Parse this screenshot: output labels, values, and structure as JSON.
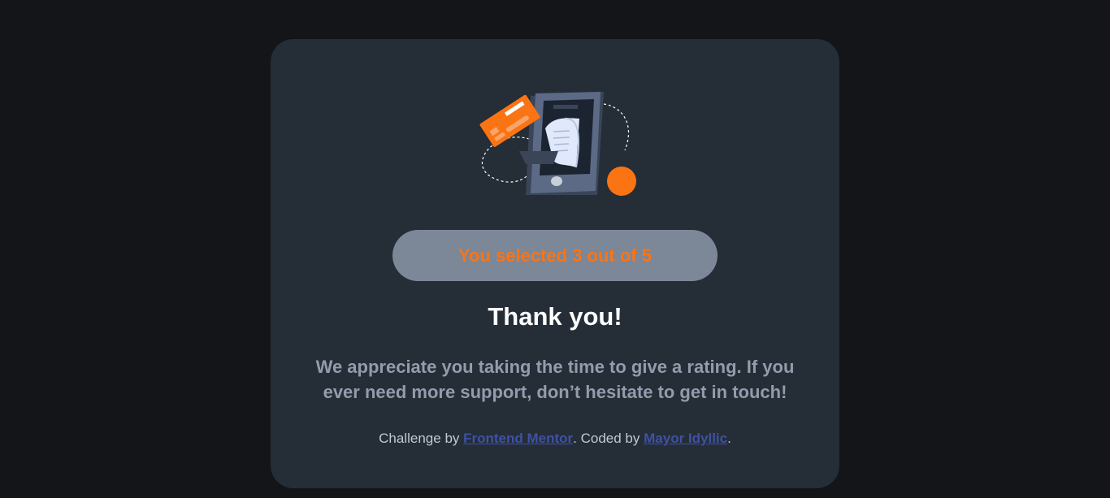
{
  "card": {
    "selected_text": "You selected 3 out of 5",
    "title": "Thank you!",
    "message": "We appreciate you taking the time to give a rating. If you ever need more support, don’t hesitate to get in touch!"
  },
  "attribution": {
    "prefix": "Challenge by ",
    "link1": "Frontend Mentor",
    "middle": ". Coded by ",
    "link2": "Mayor Idyllic",
    "suffix": "."
  },
  "colors": {
    "background": "#131518",
    "card": "#252d37",
    "accent": "#fb7413",
    "pill": "#7c8798",
    "text_muted": "#929cac",
    "link": "#3e52a3"
  },
  "icons": {
    "illustration": "phone-receipt-card-illustration"
  }
}
